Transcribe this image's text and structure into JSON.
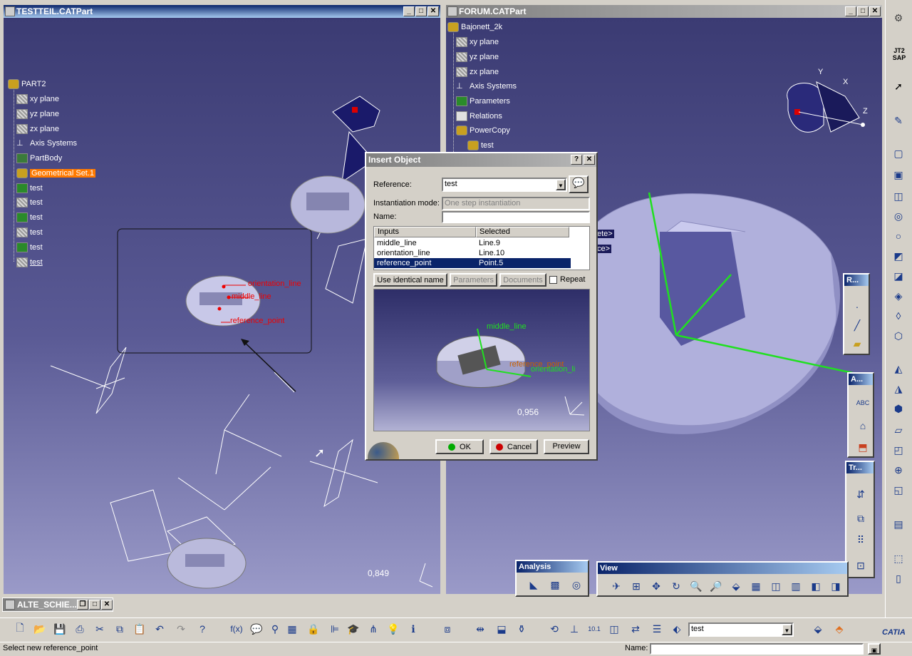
{
  "left_window": {
    "title": "TESTTEIL.CATPart",
    "tree": [
      "PART2",
      "xy plane",
      "yz plane",
      "zx plane",
      "Axis Systems",
      "PartBody",
      "Geometrical Set.1",
      "test",
      "test",
      "test",
      "test",
      "test",
      "test"
    ],
    "annotation_labels": [
      "orientation_line",
      "middle_line",
      "reference_point"
    ],
    "scale_readout": "0,849"
  },
  "right_window": {
    "title": "FORUM.CATPart",
    "tree": [
      "Bajonett_2k",
      "xy plane",
      "yz plane",
      "zx plane",
      "Axis Systems",
      "Parameters",
      "Relations",
      "PowerCopy",
      "test"
    ],
    "partial_labels": [
      "ete>",
      "ce>"
    ]
  },
  "minimized_window": {
    "title": "ALTE_SCHIE..."
  },
  "dialog": {
    "title": "Insert Object",
    "help_button": "?",
    "close_button": "X",
    "reference_label": "Reference:",
    "reference_value": "test",
    "instantiation_label": "Instantiation mode:",
    "instantiation_value": "One step instantiation",
    "name_label": "Name:",
    "name_value": "",
    "columns": [
      "Inputs",
      "Selected"
    ],
    "rows": [
      {
        "input": "middle_line",
        "selected": "Line.9"
      },
      {
        "input": "orientation_line",
        "selected": "Line.10"
      },
      {
        "input": "reference_point",
        "selected": "Point.5"
      }
    ],
    "use_identical_name": "Use identical name",
    "parameters": "Parameters",
    "documents": "Documents",
    "repeat": "Repeat",
    "preview_labels": [
      "middle_line",
      "reference_point",
      "orientation_li"
    ],
    "preview_scale": "0,956",
    "ok": "OK",
    "cancel": "Cancel",
    "preview": "Preview"
  },
  "floating": {
    "analysis": "Analysis",
    "view": "View",
    "r_panel": "R...",
    "a_panel": "A...",
    "tr_panel": "Tr..."
  },
  "bottom": {
    "combo_value": "test",
    "status_text": "Select new reference_point",
    "name_label": "Name:",
    "brand": "CATIA"
  },
  "right_toolbar_logo": "JT2 SAP"
}
